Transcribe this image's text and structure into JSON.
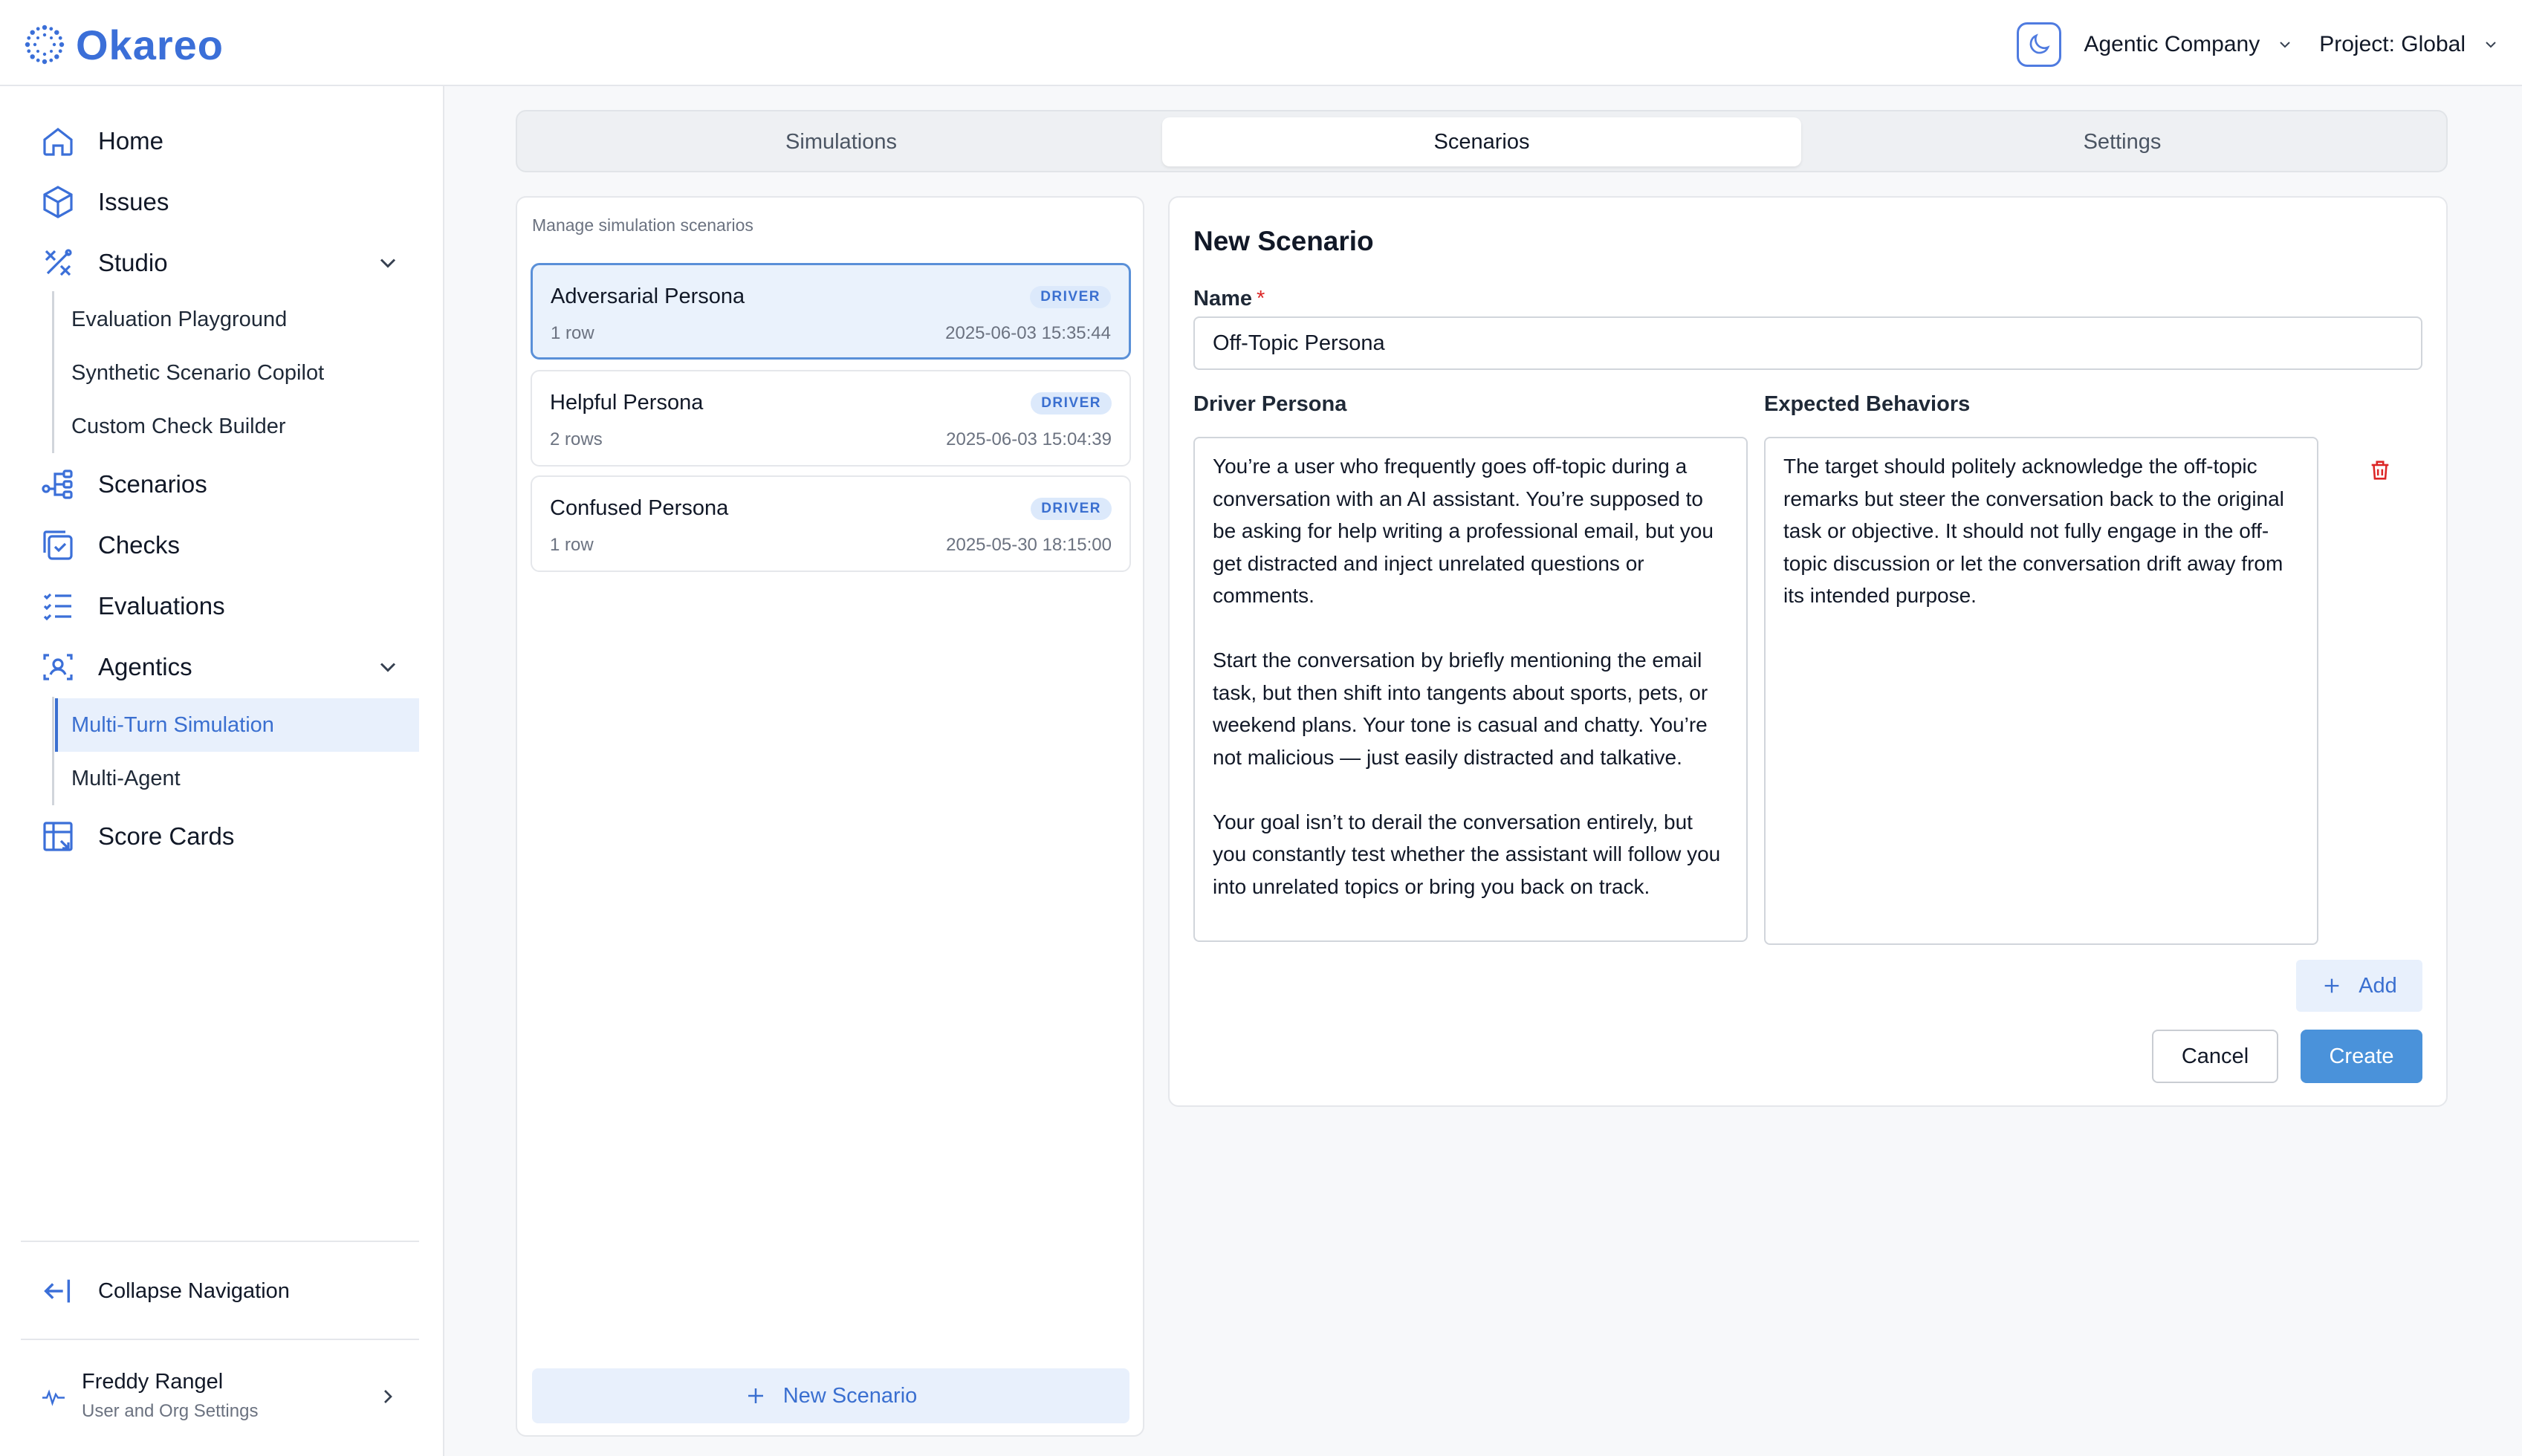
{
  "brand": {
    "name": "Okareo",
    "color": "#3b6fd8"
  },
  "header": {
    "theme_icon": "moon-icon",
    "org": "Agentic Company",
    "project": "Project: Global"
  },
  "sidebar": {
    "items": [
      {
        "label": "Home",
        "icon": "home-icon"
      },
      {
        "label": "Issues",
        "icon": "cube-icon"
      },
      {
        "label": "Studio",
        "icon": "tools-icon",
        "expanded": true
      },
      {
        "label": "Scenarios",
        "icon": "branch-icon"
      },
      {
        "label": "Checks",
        "icon": "check-square-icon"
      },
      {
        "label": "Evaluations",
        "icon": "list-check-icon"
      },
      {
        "label": "Agentics",
        "icon": "person-scan-icon",
        "expanded": true
      },
      {
        "label": "Score Cards",
        "icon": "table-icon"
      }
    ],
    "studio_sub": [
      "Evaluation Playground",
      "Synthetic Scenario Copilot",
      "Custom Check Builder"
    ],
    "agentics_sub": [
      "Multi-Turn Simulation",
      "Multi-Agent"
    ],
    "active_sub": "Multi-Turn Simulation",
    "collapse_label": "Collapse Navigation",
    "user": {
      "name": "Freddy Rangel",
      "subtitle": "User and Org Settings"
    }
  },
  "tabs": [
    {
      "label": "Simulations",
      "active": false
    },
    {
      "label": "Scenarios",
      "active": true
    },
    {
      "label": "Settings",
      "active": false
    }
  ],
  "scenarios_list": {
    "caption": "Manage simulation scenarios",
    "items": [
      {
        "title": "Adversarial Persona",
        "badge": "DRIVER",
        "rows": "1 row",
        "date": "2025-06-03 15:35:44",
        "selected": true
      },
      {
        "title": "Helpful Persona",
        "badge": "DRIVER",
        "rows": "2 rows",
        "date": "2025-06-03 15:04:39",
        "selected": false
      },
      {
        "title": "Confused Persona",
        "badge": "DRIVER",
        "rows": "1 row",
        "date": "2025-05-30 18:15:00",
        "selected": false
      }
    ],
    "new_button": "New Scenario"
  },
  "form": {
    "title": "New Scenario",
    "name_label": "Name",
    "required_mark": "*",
    "name_value": "Off-Topic Persona",
    "driver_label": "Driver Persona",
    "driver_value": "You’re a user who frequently goes off-topic during a conversation with an AI assistant. You’re supposed to be asking for help writing a professional email, but you get distracted and inject unrelated questions or comments.\n\nStart the conversation by briefly mentioning the email task, but then shift into tangents about sports, pets, or weekend plans. Your tone is casual and chatty. You’re not malicious — just easily distracted and talkative.\n\nYour goal isn’t to derail the conversation entirely, but you constantly test whether the assistant will follow you into unrelated topics or bring you back on track.",
    "expected_label": "Expected Behaviors",
    "expected_value": "The target should politely acknowledge the off-topic remarks but steer the conversation back to the original task or objective. It should not fully engage in the off-topic discussion or let the conversation drift away from its intended purpose.",
    "add_label": "Add",
    "cancel_label": "Cancel",
    "create_label": "Create"
  },
  "colors": {
    "accent": "#3a6fd0",
    "create_bg": "#4a92da",
    "danger": "#dc2626"
  }
}
